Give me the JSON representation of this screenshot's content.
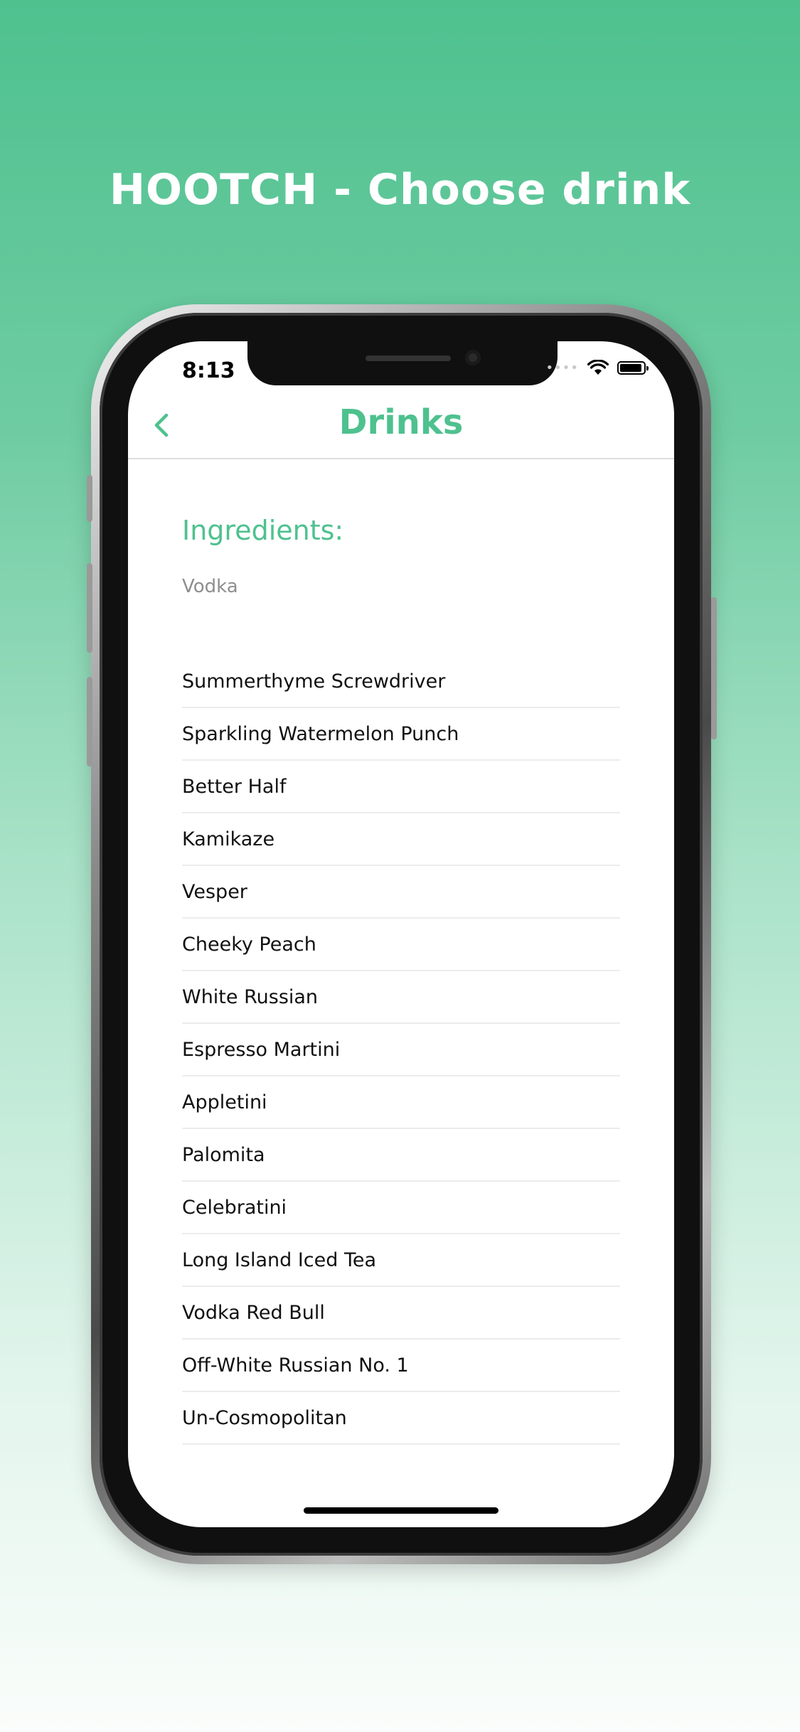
{
  "headline": "HOOTCH - Choose drink",
  "status_bar": {
    "time": "8:13"
  },
  "nav": {
    "title": "Drinks"
  },
  "ingredients": {
    "title": "Ingredients:",
    "items": [
      "Vodka"
    ]
  },
  "drinks": [
    "Summerthyme Screwdriver",
    "Sparkling Watermelon Punch",
    "Better Half",
    "Kamikaze",
    "Vesper",
    "Cheeky Peach",
    "White Russian",
    "Espresso Martini",
    "Appletini",
    "Palomita",
    "Celebratini",
    "Long Island Iced Tea",
    "Vodka Red Bull",
    "Off-White Russian No. 1",
    "Un-Cosmopolitan"
  ],
  "colors": {
    "accent": "#4ec18f",
    "background_top": "#4ec18f",
    "background_bottom": "#fafdfb"
  },
  "icons": {
    "back": "chevron-left-icon",
    "wifi": "wifi-icon",
    "battery": "battery-icon"
  }
}
